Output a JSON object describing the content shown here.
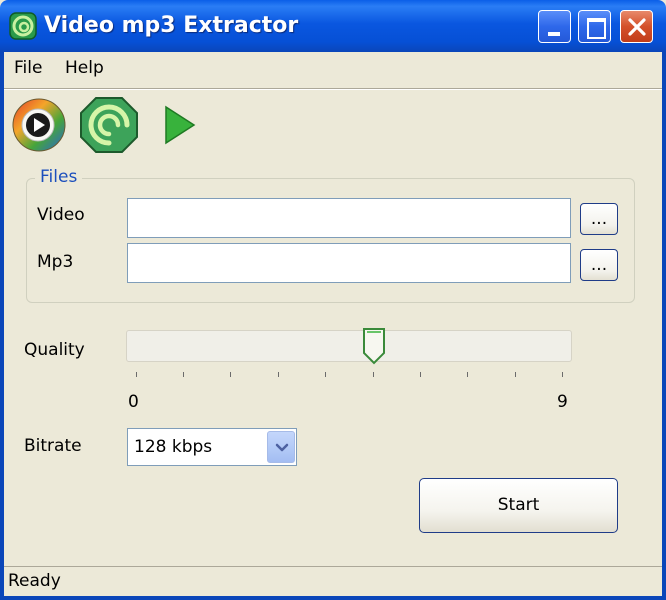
{
  "window": {
    "title": "Video mp3 Extractor"
  },
  "menu": {
    "items": [
      {
        "label": "File"
      },
      {
        "label": "Help"
      }
    ]
  },
  "toolbar": {
    "icons": [
      "media-player-icon",
      "extract-app-icon",
      "play-icon"
    ]
  },
  "files": {
    "group_label": "Files",
    "video": {
      "label": "Video",
      "value": "",
      "browse_label": "..."
    },
    "mp3": {
      "label": "Mp3",
      "value": "",
      "browse_label": "..."
    }
  },
  "quality": {
    "label": "Quality",
    "min": "0",
    "max": "9",
    "value": 5
  },
  "bitrate": {
    "label": "Bitrate",
    "selected": "128 kbps"
  },
  "start": {
    "label": "Start"
  },
  "status": {
    "text": "Ready"
  },
  "colors": {
    "titlebar": "#0a57e0",
    "window_bg": "#ece9d8",
    "group_label": "#1c4fbd",
    "close_button": "#d4502a"
  }
}
